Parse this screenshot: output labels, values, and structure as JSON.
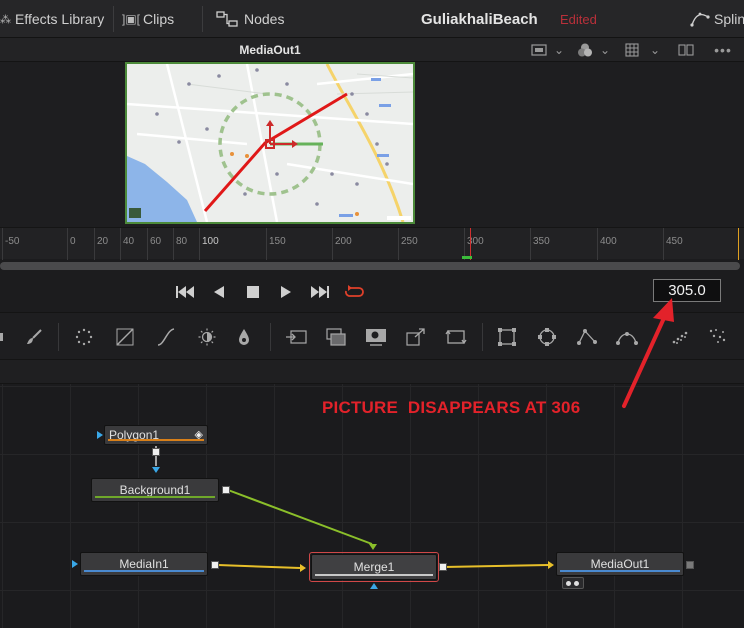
{
  "toolbar": {
    "effects_library_label": "Effects Library",
    "clips_label": "Clips",
    "nodes_label": "Nodes",
    "project_title": "GuliakhaliBeach",
    "edited_label": "Edited",
    "splines_label": "Splin"
  },
  "viewer": {
    "title": "MediaOut1"
  },
  "ruler": {
    "labels": [
      "-50",
      "0",
      "20",
      "40",
      "60",
      "80",
      "100",
      "150",
      "200",
      "250",
      "300",
      "350",
      "400",
      "450"
    ],
    "playhead_frame": 305
  },
  "transport": {
    "current_time": "305.0"
  },
  "annotation": {
    "text": "PICTURE  DISAPPEARS AT 306"
  },
  "nodes": {
    "polygon": "Polygon1",
    "background": "Background1",
    "mediain": "MediaIn1",
    "merge": "Merge1",
    "mediaout": "MediaOut1"
  },
  "colors": {
    "accent_blue": "#3aa8e8",
    "annotation_red": "#e3222a",
    "edited_red": "#b9303a",
    "link_yellow": "#e8c02a",
    "link_green": "#8bbf2a",
    "merge_outline": "#d04848"
  }
}
